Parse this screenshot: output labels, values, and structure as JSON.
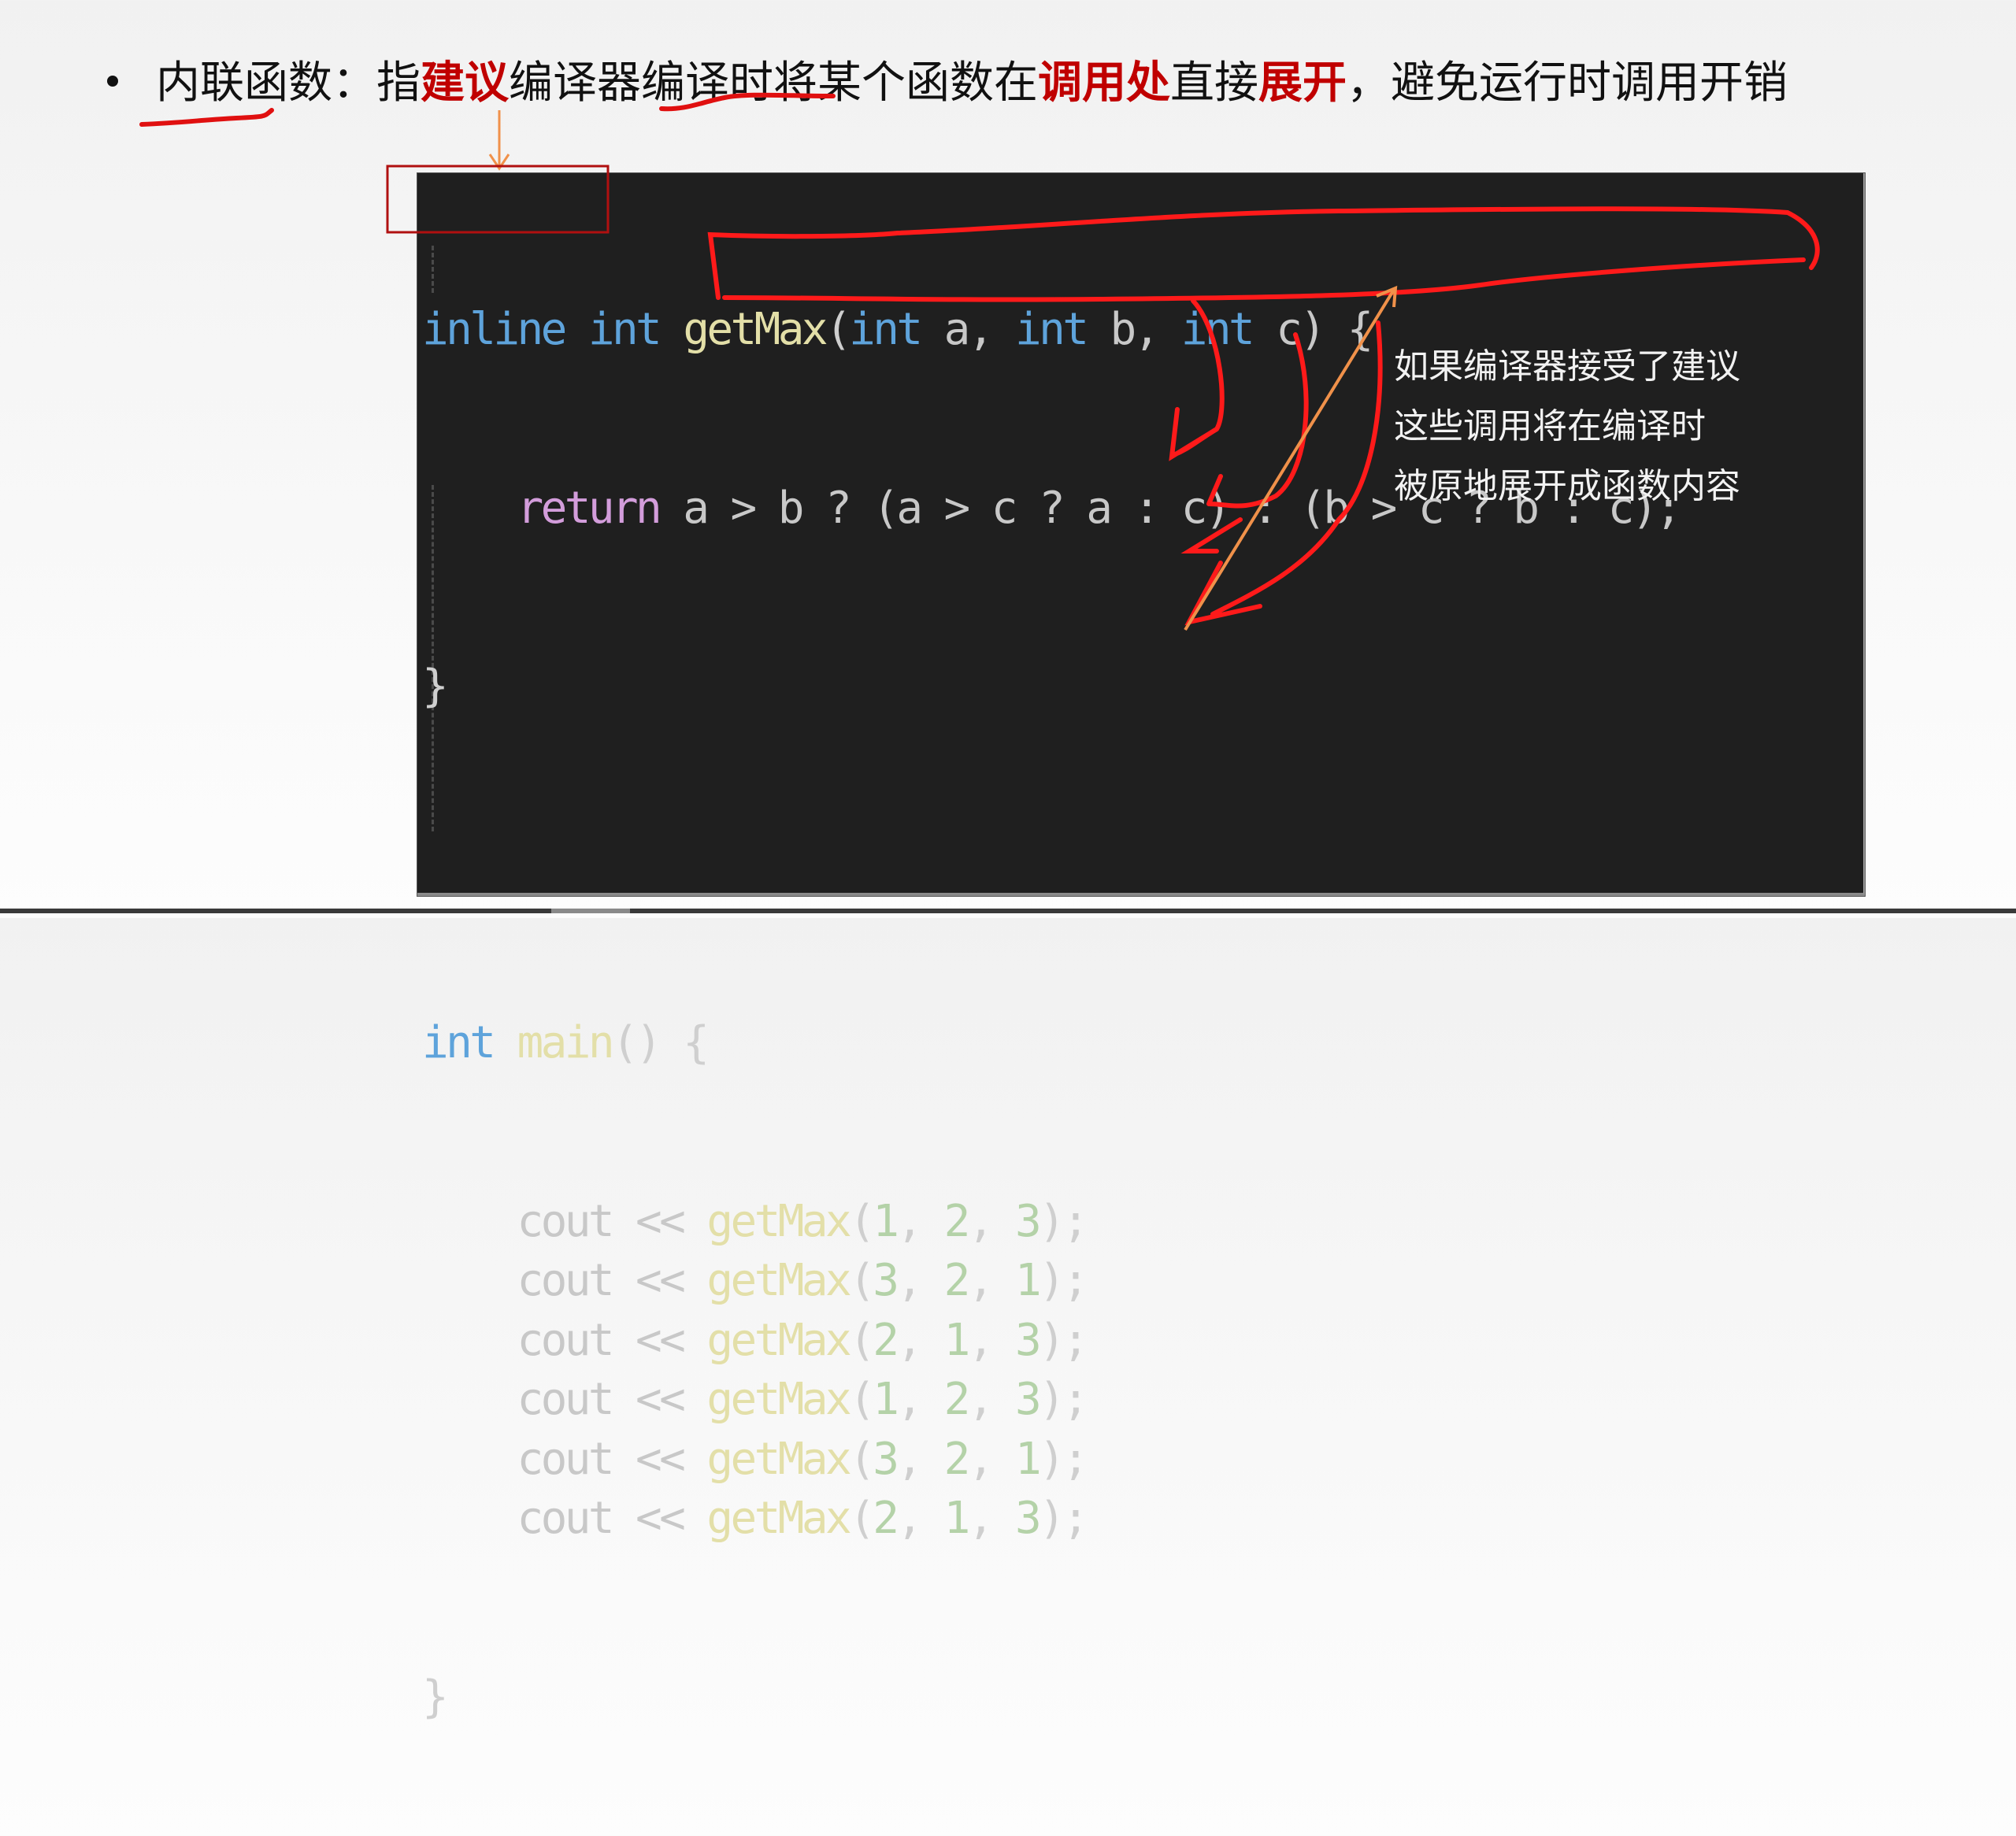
{
  "slide": {
    "bullet": {
      "term": "内联函数",
      "colon": "：",
      "parts": [
        {
          "text": "指",
          "highlight": false
        },
        {
          "text": "建议",
          "highlight": true
        },
        {
          "text": "编译器编译时将某个函数在",
          "highlight": false
        },
        {
          "text": "调用处",
          "highlight": true
        },
        {
          "text": "直接",
          "highlight": false
        },
        {
          "text": "展开",
          "highlight": true
        },
        {
          "text": "，避免运行时调用开销",
          "highlight": false
        }
      ]
    },
    "code": {
      "line1": {
        "kw_inline": "inline",
        "kw_int": "int",
        "fn": "getMax",
        "p_open": "(",
        "t1": "int",
        "a": " a, ",
        "t2": "int",
        "b": " b, ",
        "t3": "int",
        "c": " c) {"
      },
      "line2": {
        "indent": "    ",
        "kw_return": "return",
        "expr": " a > b ? (a > c ? a : c) : (b > c ? b : c);"
      },
      "line3": "}",
      "line4": "",
      "line5": {
        "kw_int": "int",
        "fn": "main",
        "rest": "() {"
      },
      "calls": [
        {
          "cout": "cout << ",
          "fn": "getMax",
          "open": "(",
          "a": "1",
          "b": "2",
          "c": "3",
          "close": ");"
        },
        {
          "cout": "cout << ",
          "fn": "getMax",
          "open": "(",
          "a": "3",
          "b": "2",
          "c": "1",
          "close": ");"
        },
        {
          "cout": "cout << ",
          "fn": "getMax",
          "open": "(",
          "a": "2",
          "b": "1",
          "c": "3",
          "close": ");"
        },
        {
          "cout": "cout << ",
          "fn": "getMax",
          "open": "(",
          "a": "1",
          "b": "2",
          "c": "3",
          "close": ");"
        },
        {
          "cout": "cout << ",
          "fn": "getMax",
          "open": "(",
          "a": "3",
          "b": "2",
          "c": "1",
          "close": ");"
        },
        {
          "cout": "cout << ",
          "fn": "getMax",
          "open": "(",
          "a": "2",
          "b": "1",
          "c": "3",
          "close": ");"
        }
      ],
      "closing": "}"
    },
    "note": {
      "lines": [
        "如果编译器接受了建议",
        "这些调用将在编译时",
        "被原地展开成函数内容"
      ]
    },
    "colors": {
      "highlight": "#c00000",
      "annotation_red": "#ff1a1a",
      "annotation_orange": "#f0914a",
      "code_bg": "#1f1f1f",
      "keyword": "#5ea3db",
      "control": "#d39ddb",
      "function": "#e3dfa8",
      "number": "#b4d2a8"
    }
  }
}
